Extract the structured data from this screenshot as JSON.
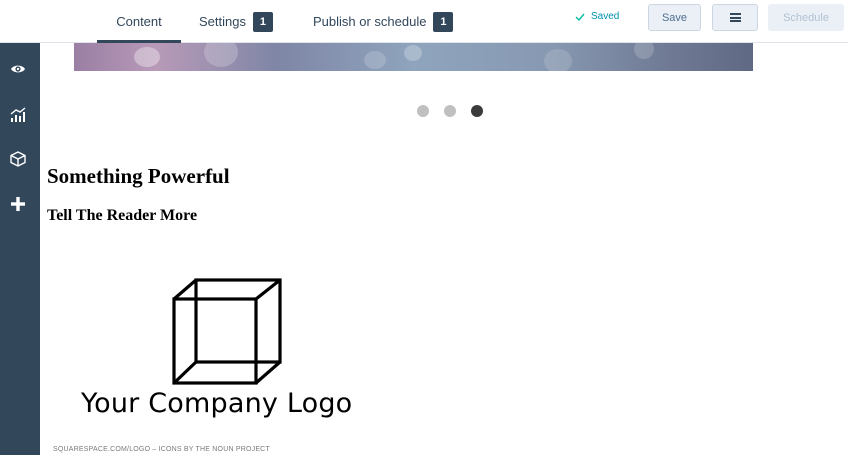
{
  "tabs": {
    "content": "Content",
    "settings": "Settings",
    "settings_count": "1",
    "publish": "Publish or schedule",
    "publish_count": "1"
  },
  "status": {
    "saved": "Saved"
  },
  "toolbar": {
    "save_label": "Save",
    "schedule_label": "Schedule"
  },
  "sidebar": {
    "icons": [
      "eye-icon",
      "analytics-icon",
      "cube-icon",
      "plus-icon"
    ]
  },
  "carousel": {
    "slide_count": 3,
    "active_index": 2
  },
  "page": {
    "heading": "Something Powerful",
    "subheading": "Tell The Reader More"
  },
  "logo": {
    "text": "Your Company Logo",
    "credit": "SQUARESPACE.COM/LOGO – ICONS BY THE NOUN PROJECT"
  },
  "colors": {
    "sidebar": "#33475b",
    "accent": "#0091ae",
    "button_bg": "#eaf0f6"
  }
}
